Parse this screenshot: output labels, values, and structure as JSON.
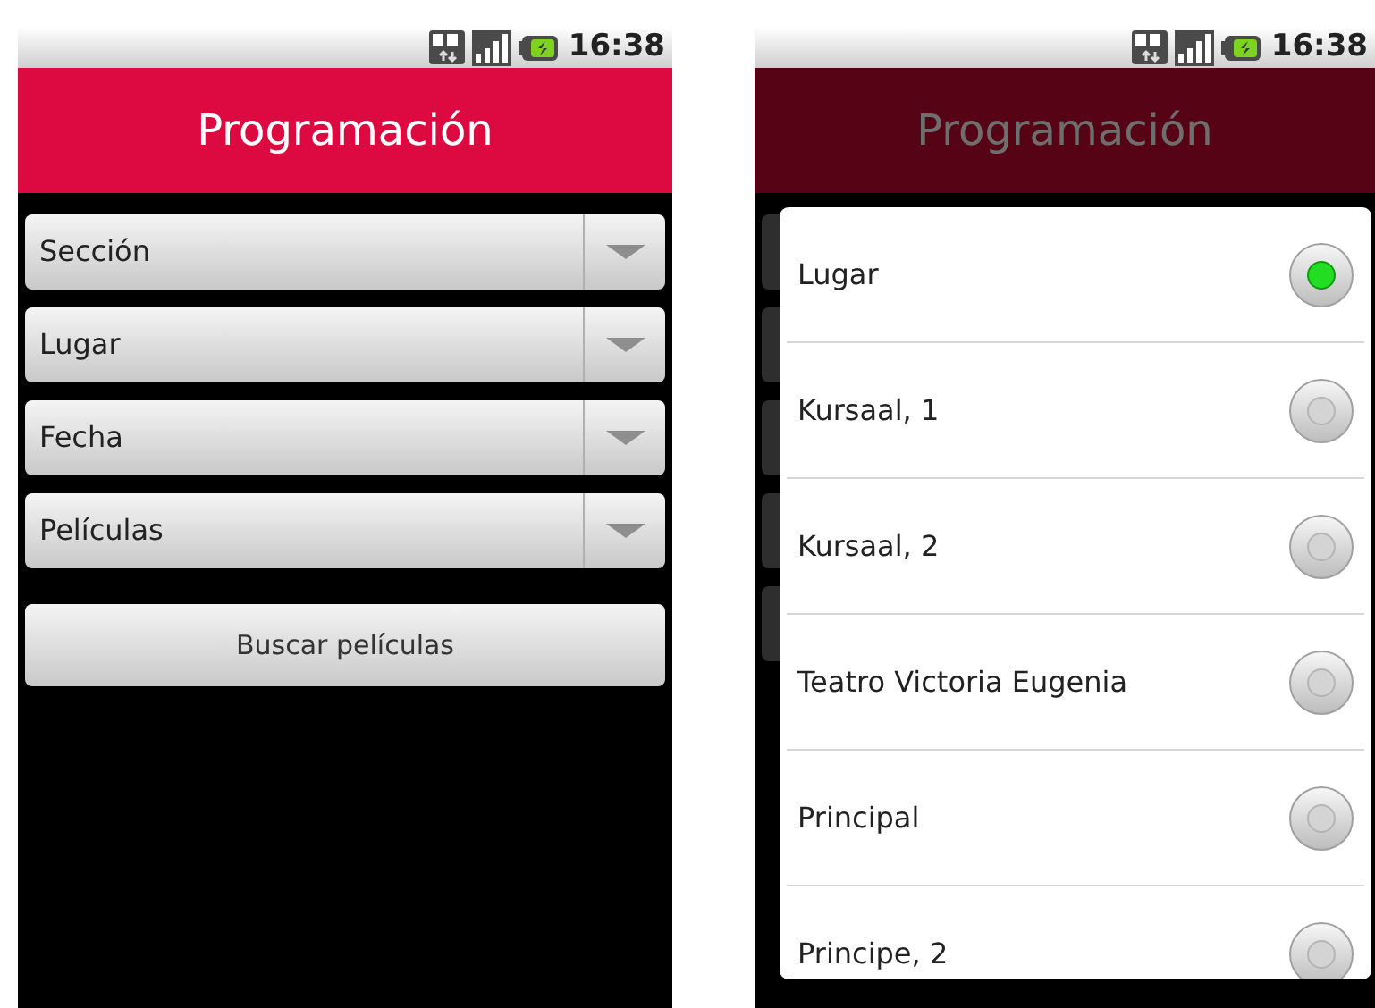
{
  "screens": [
    {
      "status_bar": {
        "time": "16:38"
      },
      "title": "Programación",
      "dimmed": false,
      "spinners": [
        {
          "label": "Sección"
        },
        {
          "label": "Lugar"
        },
        {
          "label": "Fecha"
        },
        {
          "label": "Películas"
        }
      ],
      "button": "Buscar películas"
    },
    {
      "status_bar": {
        "time": "16:38"
      },
      "title": "Programación",
      "dimmed": true,
      "dialog": {
        "options": [
          {
            "label": "Lugar",
            "selected": true
          },
          {
            "label": "Kursaal, 1",
            "selected": false
          },
          {
            "label": "Kursaal, 2",
            "selected": false
          },
          {
            "label": "Teatro Victoria Eugenia",
            "selected": false
          },
          {
            "label": "Principal",
            "selected": false
          },
          {
            "label": "Principe, 2",
            "selected": false
          }
        ]
      }
    }
  ]
}
